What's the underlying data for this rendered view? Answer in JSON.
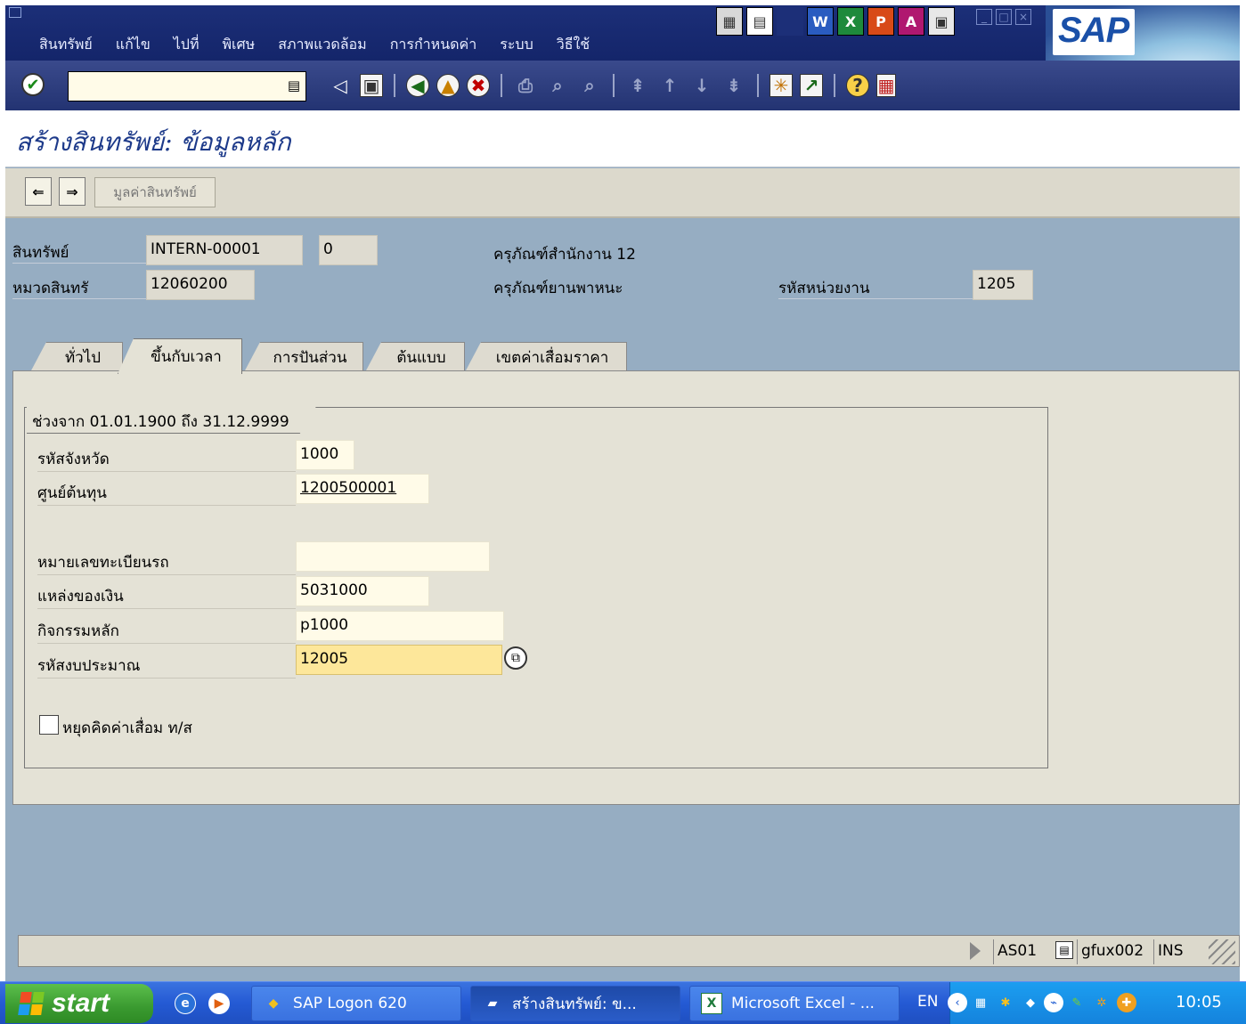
{
  "menu": {
    "items": [
      "สินทรัพย์",
      "แก้ไข",
      "ไปที่",
      "พิเศษ",
      "สภาพแวดล้อม",
      "การกำหนดค่า",
      "ระบบ",
      "วิธีใช้"
    ]
  },
  "logo": "SAP",
  "toolbar": {
    "command_value": ""
  },
  "title": "สร้างสินทรัพย์: ข้อมูลหลัก",
  "app_toolbar": {
    "asset_values_label": "มูลค่าสินทรัพย์"
  },
  "header": {
    "asset_label": "สินทรัพย์",
    "asset_number": "INTERN-00001",
    "asset_subnumber": "0",
    "asset_description": "ครุภัณฑ์สำนักงาน 12",
    "asset_class_label": "หมวดสินทรั",
    "asset_class": "12060200",
    "asset_class_description": "ครุภัณฑ์ยานพาหนะ",
    "company_code_label": "รหัสหน่วยงาน",
    "company_code": "1205"
  },
  "tabs": [
    {
      "label": "ทั่วไป",
      "active": false
    },
    {
      "label": "ขึ้นกับเวลา",
      "active": true
    },
    {
      "label": "การปันส่วน",
      "active": false
    },
    {
      "label": "ต้นแบบ",
      "active": false
    },
    {
      "label": "เขตค่าเสื่อมราคา",
      "active": false
    }
  ],
  "timedep": {
    "group_title": "ช่วงจาก 01.01.1900 ถึง 31.12.9999",
    "fields": {
      "business_area": {
        "label": "รหัสจังหวัด",
        "value": "1000"
      },
      "cost_center": {
        "label": "ศูนย์ต้นทุน",
        "value": "1200500001"
      },
      "license_plate": {
        "label": "หมายเลขทะเบียนรถ",
        "value": ""
      },
      "fund": {
        "label": "แหล่งของเงิน",
        "value": "5031000"
      },
      "functional_area": {
        "label": "กิจกรรมหลัก",
        "value": "p1000"
      },
      "budget_code": {
        "label": "รหัสงบประมาณ",
        "value": "12005"
      }
    },
    "shutdown_label": "หยุดคิดค่าเสื่อม ท/ส"
  },
  "statusbar": {
    "transaction": "AS01",
    "server": "gfux002",
    "mode": "INS"
  },
  "taskbar": {
    "start_label": "start",
    "tasks": [
      "SAP Logon 620",
      "สร้างสินทรัพย์: ข...",
      "Microsoft Excel - ..."
    ],
    "language": "EN",
    "clock": "10:05"
  }
}
